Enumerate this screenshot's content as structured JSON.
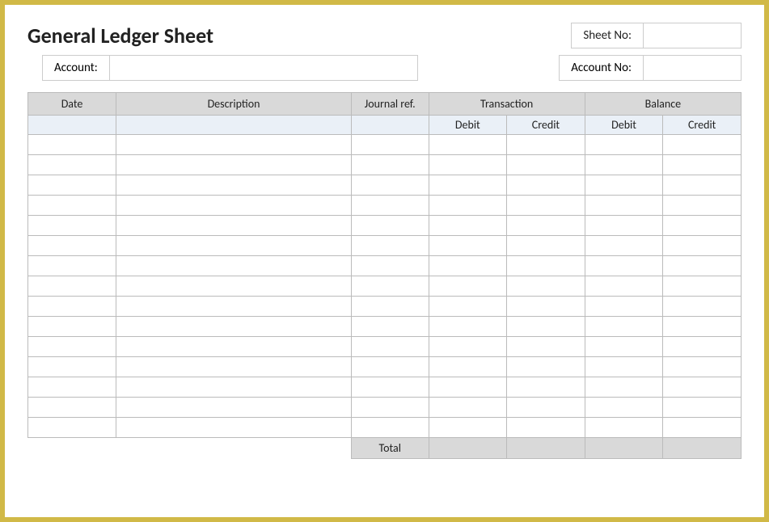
{
  "title": "General Ledger Sheet",
  "header_fields": {
    "sheet_no_label": "Sheet No:",
    "sheet_no_value": "",
    "account_label": "Account:",
    "account_value": "",
    "account_no_label": "Account No:",
    "account_no_value": ""
  },
  "table": {
    "headers": {
      "date": "Date",
      "description": "Description",
      "journal_ref": "Journal ref.",
      "transaction": "Transaction",
      "balance": "Balance"
    },
    "sub_headers": {
      "trans_debit": "Debit",
      "trans_credit": "Credit",
      "bal_debit": "Debit",
      "bal_credit": "Credit"
    },
    "rows": [
      {
        "date": "",
        "description": "",
        "journal_ref": "",
        "trans_debit": "",
        "trans_credit": "",
        "bal_debit": "",
        "bal_credit": ""
      },
      {
        "date": "",
        "description": "",
        "journal_ref": "",
        "trans_debit": "",
        "trans_credit": "",
        "bal_debit": "",
        "bal_credit": ""
      },
      {
        "date": "",
        "description": "",
        "journal_ref": "",
        "trans_debit": "",
        "trans_credit": "",
        "bal_debit": "",
        "bal_credit": ""
      },
      {
        "date": "",
        "description": "",
        "journal_ref": "",
        "trans_debit": "",
        "trans_credit": "",
        "bal_debit": "",
        "bal_credit": ""
      },
      {
        "date": "",
        "description": "",
        "journal_ref": "",
        "trans_debit": "",
        "trans_credit": "",
        "bal_debit": "",
        "bal_credit": ""
      },
      {
        "date": "",
        "description": "",
        "journal_ref": "",
        "trans_debit": "",
        "trans_credit": "",
        "bal_debit": "",
        "bal_credit": ""
      },
      {
        "date": "",
        "description": "",
        "journal_ref": "",
        "trans_debit": "",
        "trans_credit": "",
        "bal_debit": "",
        "bal_credit": ""
      },
      {
        "date": "",
        "description": "",
        "journal_ref": "",
        "trans_debit": "",
        "trans_credit": "",
        "bal_debit": "",
        "bal_credit": ""
      },
      {
        "date": "",
        "description": "",
        "journal_ref": "",
        "trans_debit": "",
        "trans_credit": "",
        "bal_debit": "",
        "bal_credit": ""
      },
      {
        "date": "",
        "description": "",
        "journal_ref": "",
        "trans_debit": "",
        "trans_credit": "",
        "bal_debit": "",
        "bal_credit": ""
      },
      {
        "date": "",
        "description": "",
        "journal_ref": "",
        "trans_debit": "",
        "trans_credit": "",
        "bal_debit": "",
        "bal_credit": ""
      },
      {
        "date": "",
        "description": "",
        "journal_ref": "",
        "trans_debit": "",
        "trans_credit": "",
        "bal_debit": "",
        "bal_credit": ""
      },
      {
        "date": "",
        "description": "",
        "journal_ref": "",
        "trans_debit": "",
        "trans_credit": "",
        "bal_debit": "",
        "bal_credit": ""
      },
      {
        "date": "",
        "description": "",
        "journal_ref": "",
        "trans_debit": "",
        "trans_credit": "",
        "bal_debit": "",
        "bal_credit": ""
      },
      {
        "date": "",
        "description": "",
        "journal_ref": "",
        "trans_debit": "",
        "trans_credit": "",
        "bal_debit": "",
        "bal_credit": ""
      }
    ],
    "footer": {
      "total_label": "Total",
      "trans_debit_total": "",
      "trans_credit_total": "",
      "bal_debit_total": "",
      "bal_credit_total": ""
    }
  }
}
